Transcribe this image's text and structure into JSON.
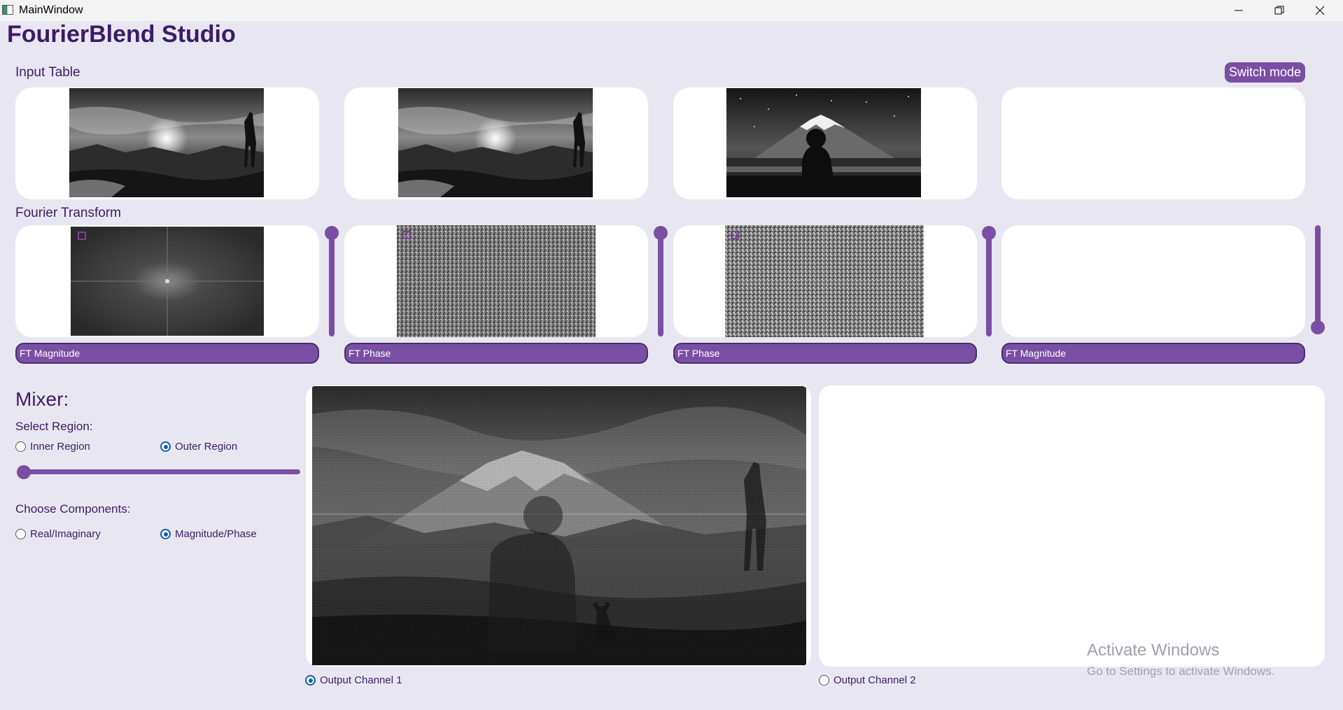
{
  "window": {
    "title": "MainWindow"
  },
  "app": {
    "title": "FourierBlend Studio"
  },
  "labels": {
    "input_table": "Input Table",
    "fourier_transform": "Fourier Transform",
    "mixer": "Mixer:",
    "select_region": "Select Region:",
    "choose_components": "Choose Components:"
  },
  "switch_mode": {
    "label": "Switch mode"
  },
  "inputs": [
    {
      "image": "sunset-silhouette-landscape",
      "loaded": true
    },
    {
      "image": "sunset-silhouette-landscape",
      "loaded": true
    },
    {
      "image": "mount-fuji-girl-cat",
      "loaded": true
    },
    {
      "image": "",
      "loaded": false
    }
  ],
  "ft_panels": [
    {
      "component": "FT Magnitude",
      "weight": 1.0,
      "pattern": "magnitude"
    },
    {
      "component": "FT Phase",
      "weight": 1.0,
      "pattern": "phase"
    },
    {
      "component": "FT Phase",
      "weight": 1.0,
      "pattern": "phase"
    },
    {
      "component": "FT Magnitude",
      "weight": 0.0,
      "pattern": "empty"
    }
  ],
  "region": {
    "inner_label": "Inner Region",
    "outer_label": "Outer Region",
    "selected": "outer",
    "size": 0.0
  },
  "components": {
    "real_imag_label": "Real/Imaginary",
    "mag_phase_label": "Magnitude/Phase",
    "selected": "mag_phase"
  },
  "outputs": {
    "channel1_label": "Output Channel 1",
    "channel2_label": "Output Channel 2",
    "selected": "channel1"
  },
  "watermark": {
    "line1": "Activate Windows",
    "line2": "Go to Settings to activate Windows."
  },
  "colors": {
    "accent": "#7a4fa3",
    "title": "#3b1c66",
    "background": "#e8e7f1",
    "radio": "#0a5fb5"
  }
}
